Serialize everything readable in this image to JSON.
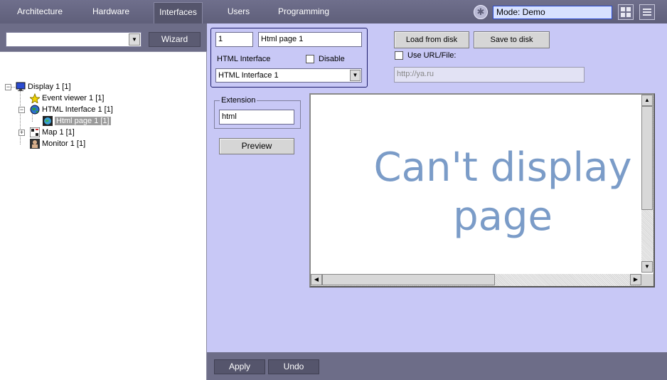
{
  "nav": {
    "tabs": [
      {
        "label": "Architecture"
      },
      {
        "label": "Hardware"
      },
      {
        "label": "Interfaces",
        "active": true
      },
      {
        "label": "Users"
      },
      {
        "label": "Programming"
      }
    ],
    "mode_text": "Mode: Demo",
    "icons": [
      "mode-icon",
      "layout-grid-icon",
      "menu-icon"
    ]
  },
  "left": {
    "combo_value": "",
    "wizard_label": "Wizard",
    "tree": [
      {
        "label": "Display 1 [1]",
        "icon": "monitor-icon",
        "expander": "−"
      },
      {
        "label": "Event viewer 1 [1]",
        "icon": "event-viewer-icon"
      },
      {
        "label": "HTML Interface 1 [1]",
        "icon": "globe-icon",
        "expander": "−"
      },
      {
        "label": "Html page 1 [1]",
        "icon": "html-page-icon",
        "selected": true
      },
      {
        "label": "Map 1 [1]",
        "icon": "map-icon",
        "expander": "+"
      },
      {
        "label": "Monitor 1 [1]",
        "icon": "camera-monitor-icon"
      }
    ]
  },
  "main": {
    "id_value": "1",
    "name_value": "Html page 1",
    "html_interface_label": "HTML Interface",
    "disable_label": "Disable",
    "interface_select_value": "HTML Interface 1",
    "load_button": "Load from disk",
    "save_button": "Save to disk",
    "use_url_label": "Use URL/File:",
    "url_value": "http://ya.ru",
    "extension_label": "Extension",
    "extension_value": "html",
    "preview_button": "Preview",
    "viewer_message": "Can't display page"
  },
  "bottom": {
    "apply_label": "Apply",
    "undo_label": "Undo"
  },
  "colors": {
    "nav_bg": "#6d6d88",
    "main_bg": "#c8c8f6",
    "mode_box_bg": "#d7e1ff",
    "message_color": "#7b9cc8"
  }
}
